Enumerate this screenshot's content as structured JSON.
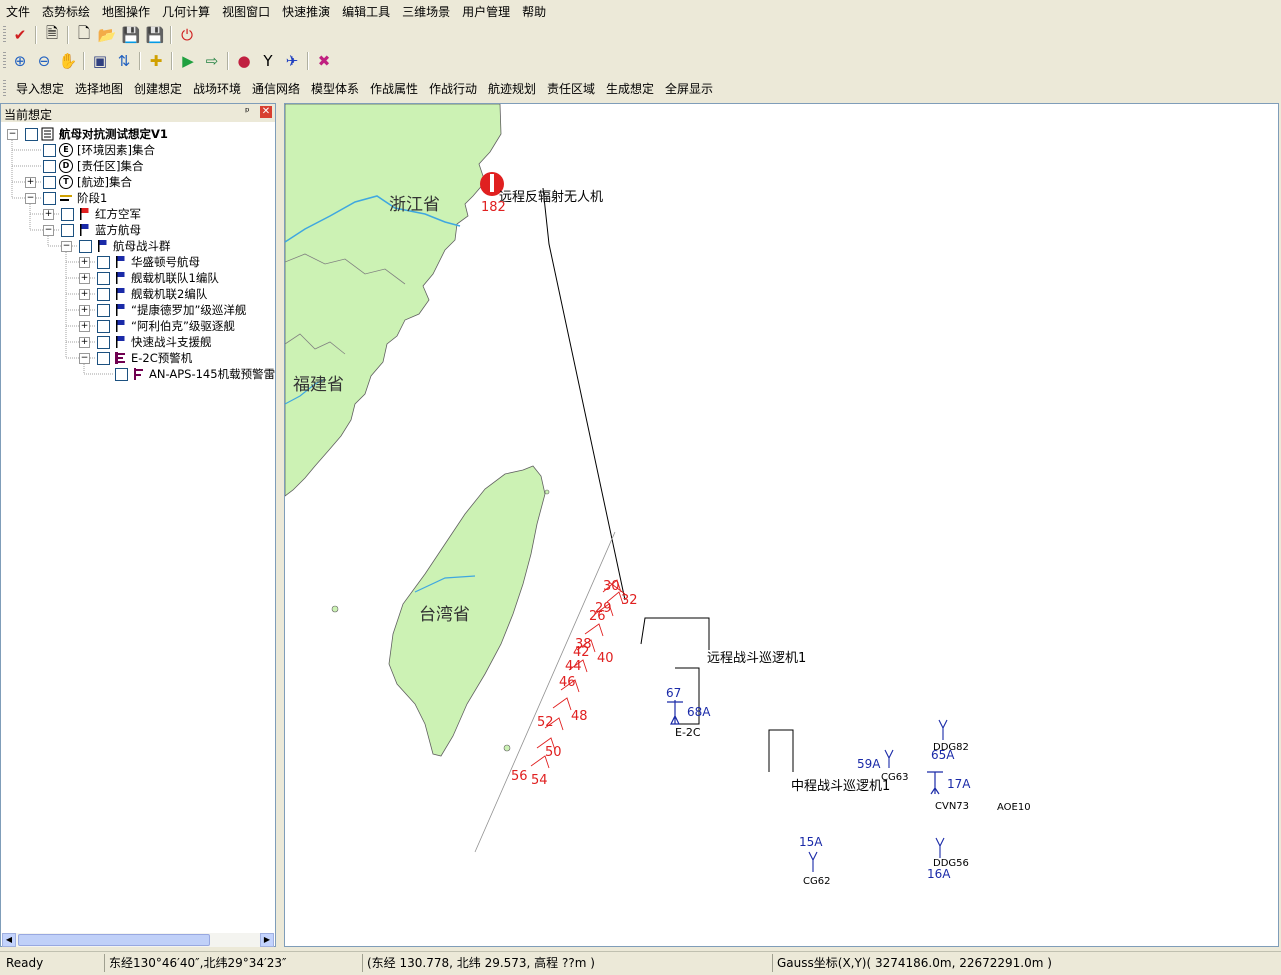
{
  "menu": [
    "文件",
    "态势标绘",
    "地图操作",
    "几何计算",
    "视图窗口",
    "快速推演",
    "编辑工具",
    "三维场景",
    "用户管理",
    "帮助"
  ],
  "toolbar_icons": {
    "row1": [
      "check-icon",
      "document-icon",
      "new-file-icon",
      "open-folder-icon",
      "save-icon",
      "save-as-icon",
      "power-icon"
    ],
    "row2": [
      "zoom-in-icon",
      "zoom-out-icon",
      "pan-hand-icon",
      "window-icon",
      "refresh-icon",
      "add-symbol-icon",
      "play-icon",
      "export-icon",
      "globe-icon",
      "measure-icon",
      "track-icon",
      "cancel-icon"
    ]
  },
  "commands": [
    "导入想定",
    "选择地图",
    "创建想定",
    "战场环境",
    "通信网络",
    "模型体系",
    "作战属性",
    "作战行动",
    "航迹规划",
    "责任区域",
    "生成想定",
    "全屏显示"
  ],
  "panel": {
    "title": "当前想定",
    "pin": "ᵖ",
    "close": "✕"
  },
  "tree": [
    {
      "label": "航母对抗测试想定V1",
      "level": 0,
      "exp": "−",
      "icon": "scenario",
      "bold": true
    },
    {
      "label": "[环境因素]集合",
      "level": 1,
      "exp": "",
      "icon": "E"
    },
    {
      "label": "[责任区]集合",
      "level": 1,
      "exp": "",
      "icon": "D"
    },
    {
      "label": "[航迹]集合",
      "level": 1,
      "exp": "+",
      "icon": "T"
    },
    {
      "label": "阶段1",
      "level": 1,
      "exp": "−",
      "icon": "stage"
    },
    {
      "label": "红方空军",
      "level": 2,
      "exp": "+",
      "icon": "redflag"
    },
    {
      "label": "蓝方航母",
      "level": 2,
      "exp": "−",
      "icon": "blueflag"
    },
    {
      "label": "航母战斗群",
      "level": 3,
      "exp": "−",
      "icon": "blueflag"
    },
    {
      "label": "华盛顿号航母",
      "level": 4,
      "exp": "+",
      "icon": "blueflag"
    },
    {
      "label": "舰载机联队1编队",
      "level": 4,
      "exp": "+",
      "icon": "blueflag"
    },
    {
      "label": "舰载机联2编队",
      "level": 4,
      "exp": "+",
      "icon": "blueflag"
    },
    {
      "label": "“提康德罗加”级巡洋舰",
      "level": 4,
      "exp": "+",
      "icon": "blueflag"
    },
    {
      "label": "“阿利伯克”级驱逐舰",
      "level": 4,
      "exp": "+",
      "icon": "blueflag"
    },
    {
      "label": "快速战斗支援舰",
      "level": 4,
      "exp": "+",
      "icon": "blueflag"
    },
    {
      "label": "E-2C预警机",
      "level": 4,
      "exp": "−",
      "icon": "e2c"
    },
    {
      "label": "AN-APS-145机载预警雷",
      "level": 5,
      "exp": "",
      "icon": "radar"
    }
  ],
  "map": {
    "province_labels": [
      "浙江省",
      "福建省",
      "台湾省"
    ],
    "red_track_numbers": [
      "30",
      "29",
      "26",
      "38",
      "42",
      "44",
      "46",
      "52",
      "50",
      "56",
      "32",
      "40",
      "48",
      "54"
    ],
    "drone_label": "远程反辐射无人机",
    "drone_number": "182",
    "units": {
      "long_patrol": "远程战斗巡逻机1",
      "mid_patrol": "中程战斗巡逻机1",
      "e2c": "E-2C",
      "e2c_num1": "67",
      "e2c_num2": "68A",
      "cg63": "CG63",
      "cg63_num": "59A",
      "ddg82": "DDG82",
      "ddg82_num": "65A",
      "cvn73": "CVN73",
      "cvn73_num": "17A",
      "aoe10": "AOE10",
      "cg62": "CG62",
      "cg62_num": "15A",
      "ddg56": "DDG56",
      "ddg56_num": "16A"
    },
    "colors": {
      "land": "#ccf2b4",
      "sea": "#ffffff",
      "river": "#3fa7e0",
      "track_red": "#e02020",
      "unit_blue": "#1a2aa8"
    }
  },
  "status": {
    "ready": "Ready",
    "lonlat": "东经130°46′40″,北纬29°34′23″",
    "lonlat_dec": "(东经 130.778, 北纬 29.573, 高程 ??m )",
    "gauss": "Gauss坐标(X,Y)( 3274186.0m, 22672291.0m )"
  }
}
